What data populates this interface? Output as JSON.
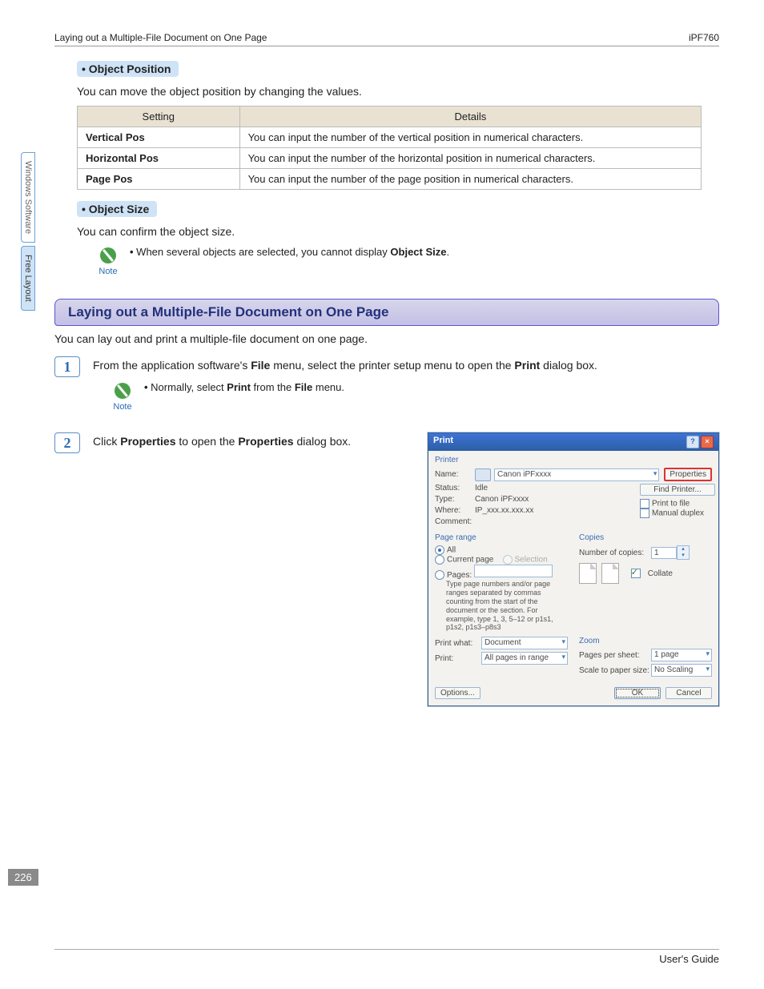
{
  "header": {
    "breadcrumb": "Laying out a Multiple-File Document on One Page",
    "model": "iPF760"
  },
  "side_tabs": {
    "tab1": "Windows Software",
    "tab2": "Free Layout"
  },
  "sec_objpos": {
    "title": "Object Position",
    "text": "You can move the object position by changing the values.",
    "table": {
      "h1": "Setting",
      "h2": "Details",
      "r1c1": "Vertical Pos",
      "r1c2": "You can input the number of the vertical position in numerical characters.",
      "r2c1": "Horizontal Pos",
      "r2c2": "You can input the number of the horizontal position in numerical characters.",
      "r3c1": "Page Pos",
      "r3c2": "You can input the number of the page position in numerical characters."
    }
  },
  "sec_objsize": {
    "title": "Object Size",
    "text": "You can confirm the object size.",
    "note_label": "Note",
    "note_pre": "When several objects are selected, you cannot display ",
    "note_bold": "Object Size",
    "note_post": "."
  },
  "heading": "Laying out a Multiple-File Document on One Page",
  "intro": "You can lay out and print a multiple-file document on one page.",
  "step1": {
    "num": "1",
    "pre": "From the application software's ",
    "b1": "File",
    "mid": " menu, select the printer setup menu to open the ",
    "b2": "Print",
    "post": " dialog box.",
    "note_label": "Note",
    "note_pre": "Normally, select ",
    "note_b1": "Print",
    "note_mid": " from the ",
    "note_b2": "File",
    "note_post": " menu."
  },
  "step2": {
    "num": "2",
    "pre": "Click ",
    "b1": "Properties",
    "mid": " to open the ",
    "b2": "Properties",
    "post": " dialog box."
  },
  "dialog": {
    "title": "Print",
    "printer": {
      "label": "Printer",
      "name_l": "Name:",
      "name_v": "Canon iPFxxxx",
      "status_l": "Status:",
      "status_v": "Idle",
      "type_l": "Type:",
      "type_v": "Canon iPFxxxx",
      "where_l": "Where:",
      "where_v": "IP_xxx.xx.xxx.xx",
      "comment_l": "Comment:",
      "properties_btn": "Properties",
      "find_btn": "Find Printer...",
      "print_to_file": "Print to file",
      "manual_duplex": "Manual duplex"
    },
    "pagerange": {
      "label": "Page range",
      "all": "All",
      "current": "Current page",
      "selection": "Selection",
      "pages": "Pages:",
      "hint": "Type page numbers and/or page ranges separated by commas counting from the start of the document or the section. For example, type 1, 3, 5–12 or p1s1, p1s2, p1s3–p8s3"
    },
    "copies": {
      "label": "Copies",
      "num_l": "Number of copies:",
      "num_v": "1",
      "collate": "Collate"
    },
    "printwhat": {
      "l": "Print what:",
      "v": "Document"
    },
    "print": {
      "l": "Print:",
      "v": "All pages in range"
    },
    "zoom": {
      "label": "Zoom",
      "pps_l": "Pages per sheet:",
      "pps_v": "1 page",
      "scale_l": "Scale to paper size:",
      "scale_v": "No Scaling"
    },
    "options_btn": "Options...",
    "ok_btn": "OK",
    "cancel_btn": "Cancel"
  },
  "page_number": "226",
  "footer": "User's Guide"
}
